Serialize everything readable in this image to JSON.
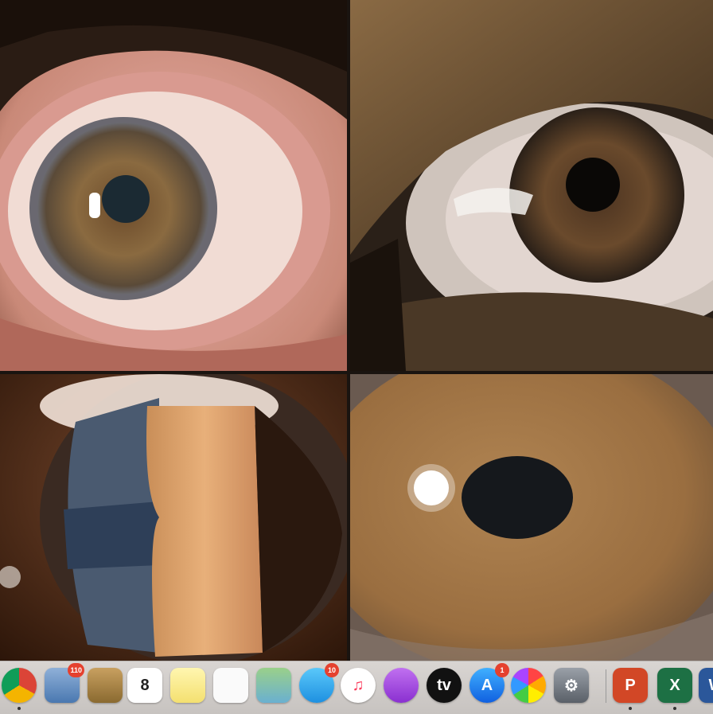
{
  "panels": [
    {
      "name": "right-eye-wide-view"
    },
    {
      "name": "left-eye-wide-view"
    },
    {
      "name": "slit-lamp-section-view"
    },
    {
      "name": "iris-closeup-view"
    }
  ],
  "dock": {
    "items": [
      {
        "name": "chrome-icon",
        "glyph": "",
        "badge": "",
        "running": true
      },
      {
        "name": "preview-icon",
        "glyph": "",
        "badge": "110",
        "running": false
      },
      {
        "name": "notes-folder-icon",
        "glyph": "",
        "badge": "",
        "running": false
      },
      {
        "name": "calendar-icon",
        "glyph": "8",
        "badge": "",
        "running": false
      },
      {
        "name": "notes-icon",
        "glyph": "",
        "badge": "",
        "running": false
      },
      {
        "name": "reminders-icon",
        "glyph": "",
        "badge": "",
        "running": false
      },
      {
        "name": "maps-icon",
        "glyph": "",
        "badge": "",
        "running": false
      },
      {
        "name": "messages-icon",
        "glyph": "",
        "badge": "10",
        "running": false
      },
      {
        "name": "music-icon",
        "glyph": "♫",
        "badge": "",
        "running": false
      },
      {
        "name": "podcasts-icon",
        "glyph": "",
        "badge": "",
        "running": false
      },
      {
        "name": "apple-tv-icon",
        "glyph": "tv",
        "badge": "",
        "running": false
      },
      {
        "name": "app-store-icon",
        "glyph": "A",
        "badge": "1",
        "running": false
      },
      {
        "name": "photos-icon",
        "glyph": "",
        "badge": "",
        "running": false
      },
      {
        "name": "system-preferences-icon",
        "glyph": "⚙",
        "badge": "",
        "running": false
      },
      {
        "name": "powerpoint-icon",
        "glyph": "P",
        "badge": "",
        "running": true
      },
      {
        "name": "excel-icon",
        "glyph": "X",
        "badge": "",
        "running": true
      },
      {
        "name": "word-icon",
        "glyph": "W",
        "badge": "",
        "running": true
      }
    ]
  }
}
